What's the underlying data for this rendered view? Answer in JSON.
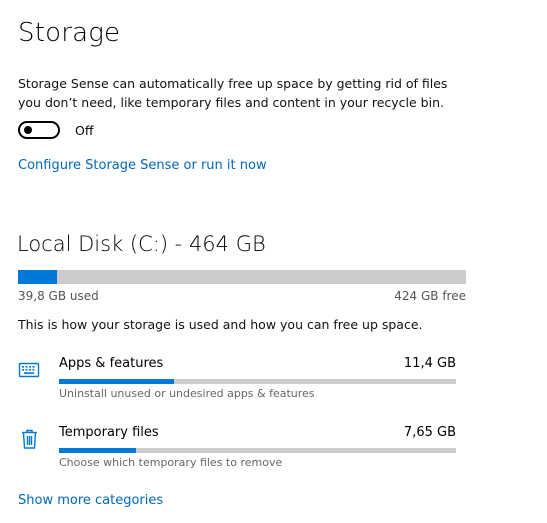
{
  "page": {
    "title": "Storage",
    "storage_sense": {
      "description": "Storage Sense can automatically free up space by getting rid of files you don’t need, like temporary files and content in your recycle bin.",
      "toggle_state": "Off",
      "toggle_on": false,
      "configure_link": "Configure Storage Sense or run it now"
    },
    "disk": {
      "title": "Local Disk (C:) - 464 GB",
      "used_label": "39,8 GB used",
      "free_label": "424 GB free",
      "used_fraction": 0.086
    },
    "info_text": "This is how your storage is used and how you can free up space.",
    "categories": [
      {
        "name": "Apps & features",
        "size": "11,4 GB",
        "description": "Uninstall unused or undesired apps & features",
        "icon": "keyboard-icon",
        "bar_fraction": 0.29
      },
      {
        "name": "Temporary files",
        "size": "7,65 GB",
        "description": "Choose which temporary files to remove",
        "icon": "trash-icon",
        "bar_fraction": 0.195
      }
    ],
    "show_more_link": "Show more categories"
  },
  "colors": {
    "accent": "#0078d7",
    "link": "#0067b8",
    "bar_track": "#cccccc",
    "secondary_text": "#555555"
  }
}
